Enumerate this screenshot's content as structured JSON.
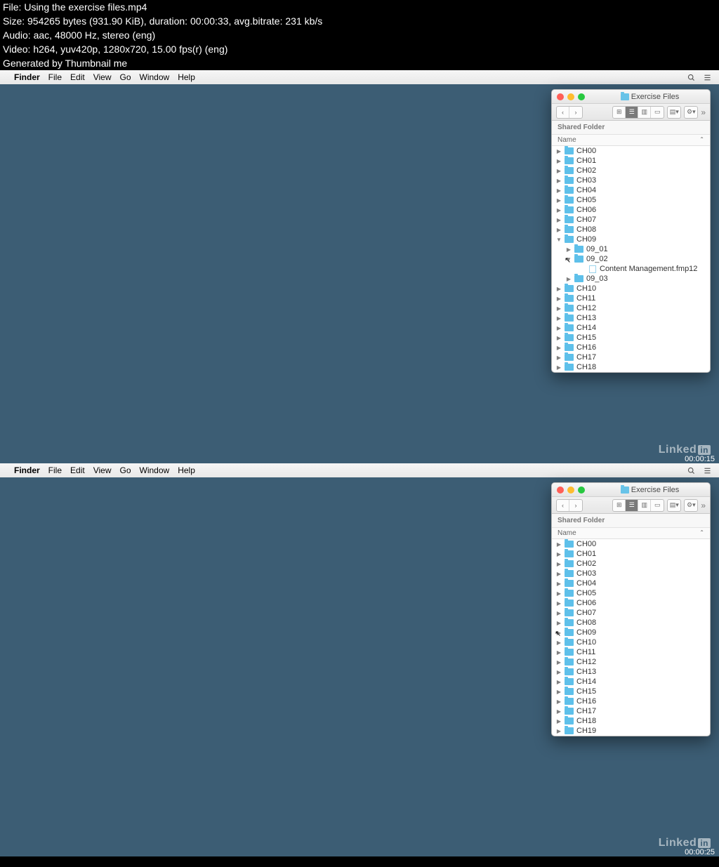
{
  "header": {
    "line1": "File: Using the exercise files.mp4",
    "line2": "Size: 954265 bytes (931.90 KiB), duration: 00:00:33, avg.bitrate: 231 kb/s",
    "line3": "Audio: aac, 48000 Hz, stereo (eng)",
    "line4": "Video: h264, yuv420p, 1280x720, 15.00 fps(r) (eng)",
    "line5": "Generated by Thumbnail me"
  },
  "menubar": {
    "app": "Finder",
    "items": [
      "File",
      "Edit",
      "View",
      "Go",
      "Window",
      "Help"
    ]
  },
  "window": {
    "title": "Exercise Files",
    "shared": "Shared Folder",
    "column": "Name"
  },
  "frame1": {
    "timestamp": "00:00:15",
    "rows": [
      {
        "indent": 0,
        "tri": "▶",
        "type": "folder",
        "name": "CH00"
      },
      {
        "indent": 0,
        "tri": "▶",
        "type": "folder",
        "name": "CH01"
      },
      {
        "indent": 0,
        "tri": "▶",
        "type": "folder",
        "name": "CH02"
      },
      {
        "indent": 0,
        "tri": "▶",
        "type": "folder",
        "name": "CH03"
      },
      {
        "indent": 0,
        "tri": "▶",
        "type": "folder",
        "name": "CH04"
      },
      {
        "indent": 0,
        "tri": "▶",
        "type": "folder",
        "name": "CH05"
      },
      {
        "indent": 0,
        "tri": "▶",
        "type": "folder",
        "name": "CH06"
      },
      {
        "indent": 0,
        "tri": "▶",
        "type": "folder",
        "name": "CH07"
      },
      {
        "indent": 0,
        "tri": "▶",
        "type": "folder",
        "name": "CH08"
      },
      {
        "indent": 0,
        "tri": "▼",
        "type": "folder",
        "name": "CH09"
      },
      {
        "indent": 1,
        "tri": "▶",
        "type": "folder",
        "name": "09_01"
      },
      {
        "indent": 1,
        "tri": "▼",
        "type": "folder",
        "name": "09_02",
        "cursor": true
      },
      {
        "indent": 2,
        "tri": "",
        "type": "doc",
        "name": "Content Management.fmp12"
      },
      {
        "indent": 1,
        "tri": "▶",
        "type": "folder",
        "name": "09_03"
      },
      {
        "indent": 0,
        "tri": "▶",
        "type": "folder",
        "name": "CH10"
      },
      {
        "indent": 0,
        "tri": "▶",
        "type": "folder",
        "name": "CH11"
      },
      {
        "indent": 0,
        "tri": "▶",
        "type": "folder",
        "name": "CH12"
      },
      {
        "indent": 0,
        "tri": "▶",
        "type": "folder",
        "name": "CH13"
      },
      {
        "indent": 0,
        "tri": "▶",
        "type": "folder",
        "name": "CH14"
      },
      {
        "indent": 0,
        "tri": "▶",
        "type": "folder",
        "name": "CH15"
      },
      {
        "indent": 0,
        "tri": "▶",
        "type": "folder",
        "name": "CH16"
      },
      {
        "indent": 0,
        "tri": "▶",
        "type": "folder",
        "name": "CH17"
      },
      {
        "indent": 0,
        "tri": "▶",
        "type": "folder",
        "name": "CH18"
      }
    ]
  },
  "frame2": {
    "timestamp": "00:00:25",
    "rows": [
      {
        "indent": 0,
        "tri": "▶",
        "type": "folder",
        "name": "CH00"
      },
      {
        "indent": 0,
        "tri": "▶",
        "type": "folder",
        "name": "CH01"
      },
      {
        "indent": 0,
        "tri": "▶",
        "type": "folder",
        "name": "CH02"
      },
      {
        "indent": 0,
        "tri": "▶",
        "type": "folder",
        "name": "CH03"
      },
      {
        "indent": 0,
        "tri": "▶",
        "type": "folder",
        "name": "CH04"
      },
      {
        "indent": 0,
        "tri": "▶",
        "type": "folder",
        "name": "CH05"
      },
      {
        "indent": 0,
        "tri": "▶",
        "type": "folder",
        "name": "CH06"
      },
      {
        "indent": 0,
        "tri": "▶",
        "type": "folder",
        "name": "CH07"
      },
      {
        "indent": 0,
        "tri": "▶",
        "type": "folder",
        "name": "CH08"
      },
      {
        "indent": 0,
        "tri": "▶",
        "type": "folder",
        "name": "CH09",
        "cursor": true
      },
      {
        "indent": 0,
        "tri": "▶",
        "type": "folder",
        "name": "CH10"
      },
      {
        "indent": 0,
        "tri": "▶",
        "type": "folder",
        "name": "CH11"
      },
      {
        "indent": 0,
        "tri": "▶",
        "type": "folder",
        "name": "CH12"
      },
      {
        "indent": 0,
        "tri": "▶",
        "type": "folder",
        "name": "CH13"
      },
      {
        "indent": 0,
        "tri": "▶",
        "type": "folder",
        "name": "CH14"
      },
      {
        "indent": 0,
        "tri": "▶",
        "type": "folder",
        "name": "CH15"
      },
      {
        "indent": 0,
        "tri": "▶",
        "type": "folder",
        "name": "CH16"
      },
      {
        "indent": 0,
        "tri": "▶",
        "type": "folder",
        "name": "CH17"
      },
      {
        "indent": 0,
        "tri": "▶",
        "type": "folder",
        "name": "CH18"
      },
      {
        "indent": 0,
        "tri": "▶",
        "type": "folder",
        "name": "CH19"
      }
    ]
  },
  "watermark": "Linked"
}
